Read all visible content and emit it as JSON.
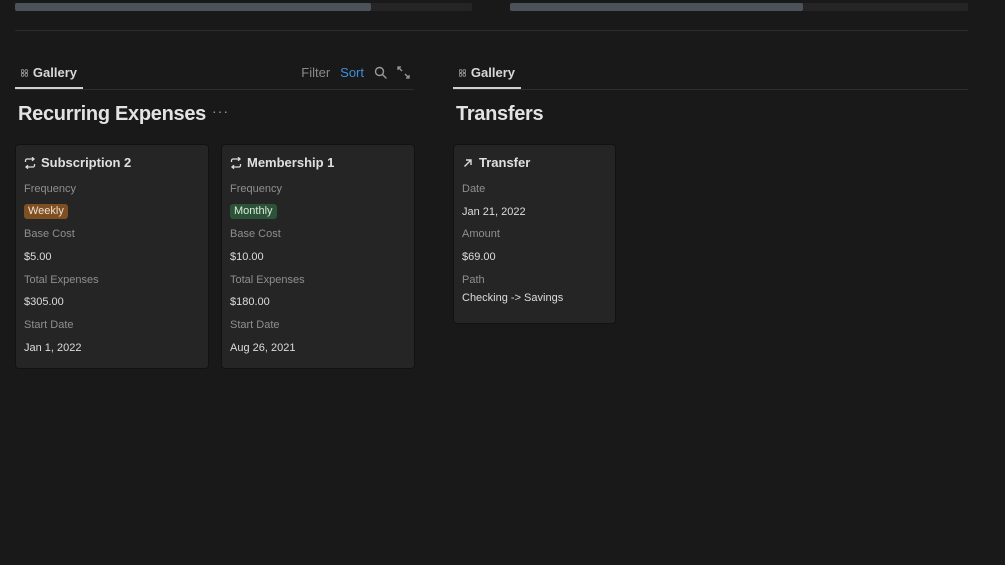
{
  "colors": {
    "background": "#191919",
    "card": "#252525",
    "accent": "#3d8fdb",
    "badge_weekly": "#7e4f23",
    "badge_monthly": "#2c5237"
  },
  "progress": [
    {
      "fill_fraction": 0.78
    },
    {
      "fill_fraction": 0.64
    }
  ],
  "left": {
    "tab_label": "Gallery",
    "tab_icon": "grid-icon",
    "toolbar": {
      "filter_label": "Filter",
      "sort_label": "Sort",
      "search_icon": "search-icon",
      "expand_icon": "expand-icon"
    },
    "title": "Recurring Expenses",
    "more_label": "···",
    "cards": [
      {
        "icon": "repeat-icon",
        "title": "Subscription 2",
        "frequency_label": "Frequency",
        "frequency_value": "Weekly",
        "base_cost_label": "Base Cost",
        "base_cost_value": "$5.00",
        "total_expenses_label": "Total Expenses",
        "total_expenses_value": "$305.00",
        "start_date_label": "Start Date",
        "start_date_value": "Jan 1, 2022"
      },
      {
        "icon": "repeat-icon",
        "title": "Membership 1",
        "frequency_label": "Frequency",
        "frequency_value": "Monthly",
        "base_cost_label": "Base Cost",
        "base_cost_value": "$10.00",
        "total_expenses_label": "Total Expenses",
        "total_expenses_value": "$180.00",
        "start_date_label": "Start Date",
        "start_date_value": "Aug 26, 2021"
      }
    ]
  },
  "right": {
    "tab_label": "Gallery",
    "tab_icon": "grid-icon",
    "title": "Transfers",
    "cards": [
      {
        "icon": "arrow-up-right-icon",
        "title": "Transfer",
        "date_label": "Date",
        "date_value": "Jan 21, 2022",
        "amount_label": "Amount",
        "amount_value": "$69.00",
        "path_label": "Path",
        "path_value": "Checking -> Savings"
      }
    ]
  }
}
